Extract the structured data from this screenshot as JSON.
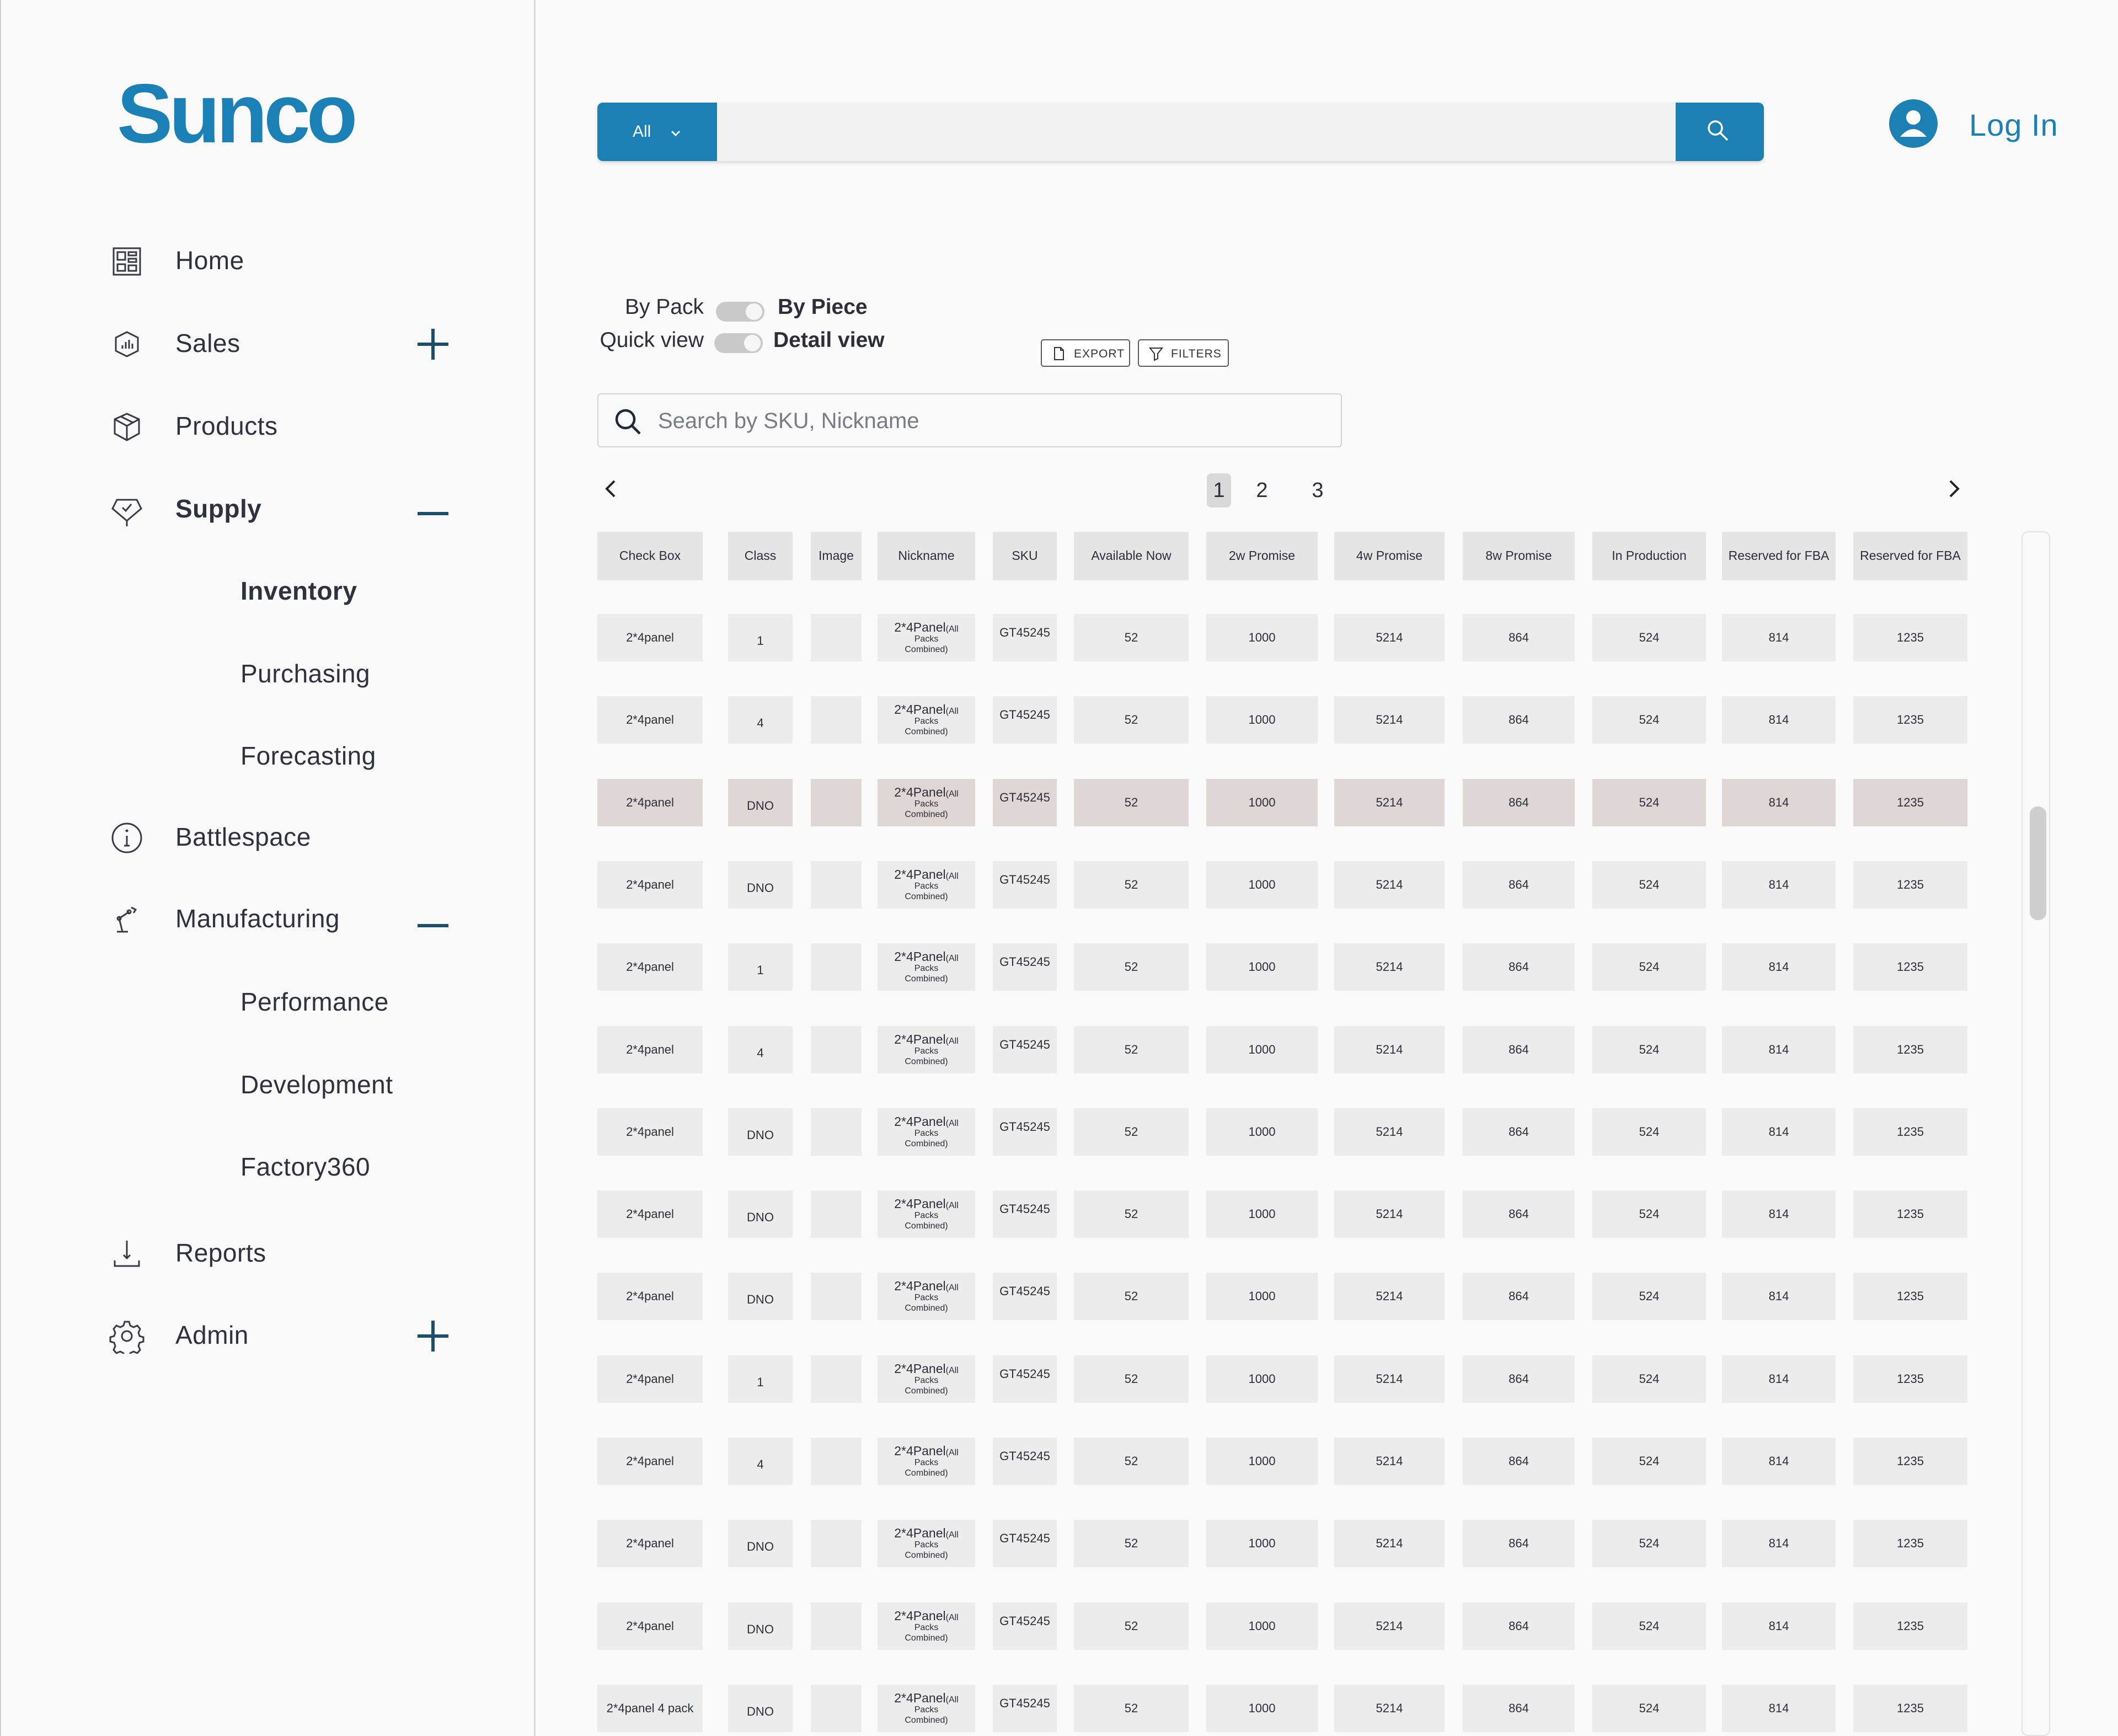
{
  "brand": {
    "logo": "Sunco"
  },
  "sidebar": {
    "items": [
      {
        "label": "Home",
        "icon": "dashboard-icon",
        "toggle": null
      },
      {
        "label": "Sales",
        "icon": "sales-icon",
        "toggle": "plus"
      },
      {
        "label": "Products",
        "icon": "box-icon",
        "toggle": null
      },
      {
        "label": "Supply",
        "icon": "supply-icon",
        "toggle": "minus",
        "active": true,
        "children": [
          {
            "label": "Inventory",
            "active": true
          },
          {
            "label": "Purchasing"
          },
          {
            "label": "Forecasting"
          }
        ]
      },
      {
        "label": "Battlespace",
        "icon": "info-icon",
        "toggle": null
      },
      {
        "label": "Manufacturing",
        "icon": "robot-arm-icon",
        "toggle": "minus",
        "children": [
          {
            "label": "Performance"
          },
          {
            "label": "Development"
          },
          {
            "label": "Factory360"
          }
        ]
      },
      {
        "label": "Reports",
        "icon": "download-icon",
        "toggle": null
      },
      {
        "label": "Admin",
        "icon": "gear-icon",
        "toggle": "plus"
      }
    ]
  },
  "header": {
    "search": {
      "category": "All",
      "value": ""
    },
    "login_label": "Log In"
  },
  "view_toggles": {
    "pack": {
      "off_label": "By Pack",
      "on_label": "By Piece"
    },
    "view": {
      "off_label": "Quick view",
      "on_label": "Detail view"
    }
  },
  "actions": {
    "export_label": "EXPORT",
    "filters_label": "FILTERS"
  },
  "sku_search": {
    "placeholder": "Search by SKU, Nickname"
  },
  "pagination": {
    "pages": [
      "1",
      "2",
      "3"
    ],
    "current": "1"
  },
  "table": {
    "columns": [
      "Check Box",
      "Class",
      "Image",
      "Nickname",
      "SKU",
      "Available Now",
      "2w Promise",
      "4w Promise",
      "8w Promise",
      "In Production",
      "Reserved for FBA",
      "Reserved for FBA"
    ],
    "rows": [
      {
        "check": "2*4panel",
        "class": "1",
        "nick": "2*4Panel",
        "nick_note1": "(All",
        "nick_note2": "Packs",
        "nick_note3": "Combined)",
        "sku": "GT45245",
        "avail": "52",
        "w2": "1000",
        "w4": "5214",
        "w8": "864",
        "prod": "524",
        "fba1": "814",
        "fba2": "1235"
      },
      {
        "check": "2*4panel",
        "class": "4",
        "nick": "2*4Panel",
        "nick_note1": "(All",
        "nick_note2": "Packs",
        "nick_note3": "Combined)",
        "sku": "GT45245",
        "avail": "52",
        "w2": "1000",
        "w4": "5214",
        "w8": "864",
        "prod": "524",
        "fba1": "814",
        "fba2": "1235"
      },
      {
        "check": "2*4panel",
        "class": "DNO",
        "nick": "2*4Panel",
        "nick_note1": "(All",
        "nick_note2": "Packs",
        "nick_note3": "Combined)",
        "sku": "GT45245",
        "avail": "52",
        "w2": "1000",
        "w4": "5214",
        "w8": "864",
        "prod": "524",
        "fba1": "814",
        "fba2": "1235",
        "highlight": true
      },
      {
        "check": "2*4panel",
        "class": "DNO",
        "nick": "2*4Panel",
        "nick_note1": "(All",
        "nick_note2": "Packs",
        "nick_note3": "Combined)",
        "sku": "GT45245",
        "avail": "52",
        "w2": "1000",
        "w4": "5214",
        "w8": "864",
        "prod": "524",
        "fba1": "814",
        "fba2": "1235"
      },
      {
        "check": "2*4panel",
        "class": "1",
        "nick": "2*4Panel",
        "nick_note1": "(All",
        "nick_note2": "Packs",
        "nick_note3": "Combined)",
        "sku": "GT45245",
        "avail": "52",
        "w2": "1000",
        "w4": "5214",
        "w8": "864",
        "prod": "524",
        "fba1": "814",
        "fba2": "1235"
      },
      {
        "check": "2*4panel",
        "class": "4",
        "nick": "2*4Panel",
        "nick_note1": "(All",
        "nick_note2": "Packs",
        "nick_note3": "Combined)",
        "sku": "GT45245",
        "avail": "52",
        "w2": "1000",
        "w4": "5214",
        "w8": "864",
        "prod": "524",
        "fba1": "814",
        "fba2": "1235"
      },
      {
        "check": "2*4panel",
        "class": "DNO",
        "nick": "2*4Panel",
        "nick_note1": "(All",
        "nick_note2": "Packs",
        "nick_note3": "Combined)",
        "sku": "GT45245",
        "avail": "52",
        "w2": "1000",
        "w4": "5214",
        "w8": "864",
        "prod": "524",
        "fba1": "814",
        "fba2": "1235"
      },
      {
        "check": "2*4panel",
        "class": "DNO",
        "nick": "2*4Panel",
        "nick_note1": "(All",
        "nick_note2": "Packs",
        "nick_note3": "Combined)",
        "sku": "GT45245",
        "avail": "52",
        "w2": "1000",
        "w4": "5214",
        "w8": "864",
        "prod": "524",
        "fba1": "814",
        "fba2": "1235"
      },
      {
        "check": "2*4panel",
        "class": "DNO",
        "nick": "2*4Panel",
        "nick_note1": "(All",
        "nick_note2": "Packs",
        "nick_note3": "Combined)",
        "sku": "GT45245",
        "avail": "52",
        "w2": "1000",
        "w4": "5214",
        "w8": "864",
        "prod": "524",
        "fba1": "814",
        "fba2": "1235"
      },
      {
        "check": "2*4panel",
        "class": "1",
        "nick": "2*4Panel",
        "nick_note1": "(All",
        "nick_note2": "Packs",
        "nick_note3": "Combined)",
        "sku": "GT45245",
        "avail": "52",
        "w2": "1000",
        "w4": "5214",
        "w8": "864",
        "prod": "524",
        "fba1": "814",
        "fba2": "1235"
      },
      {
        "check": "2*4panel",
        "class": "4",
        "nick": "2*4Panel",
        "nick_note1": "(All",
        "nick_note2": "Packs",
        "nick_note3": "Combined)",
        "sku": "GT45245",
        "avail": "52",
        "w2": "1000",
        "w4": "5214",
        "w8": "864",
        "prod": "524",
        "fba1": "814",
        "fba2": "1235"
      },
      {
        "check": "2*4panel",
        "class": "DNO",
        "nick": "2*4Panel",
        "nick_note1": "(All",
        "nick_note2": "Packs",
        "nick_note3": "Combined)",
        "sku": "GT45245",
        "avail": "52",
        "w2": "1000",
        "w4": "5214",
        "w8": "864",
        "prod": "524",
        "fba1": "814",
        "fba2": "1235"
      },
      {
        "check": "2*4panel",
        "class": "DNO",
        "nick": "2*4Panel",
        "nick_note1": "(All",
        "nick_note2": "Packs",
        "nick_note3": "Combined)",
        "sku": "GT45245",
        "avail": "52",
        "w2": "1000",
        "w4": "5214",
        "w8": "864",
        "prod": "524",
        "fba1": "814",
        "fba2": "1235"
      },
      {
        "check": "2*4panel 4 pack",
        "class": "DNO",
        "nick": "2*4Panel",
        "nick_note1": "(All",
        "nick_note2": "Packs",
        "nick_note3": "Combined)",
        "sku": "GT45245",
        "avail": "52",
        "w2": "1000",
        "w4": "5214",
        "w8": "864",
        "prod": "524",
        "fba1": "814",
        "fba2": "1235"
      }
    ]
  },
  "colors": {
    "brand": "#1a80b6",
    "highlight_row": "#dfd6d6",
    "cell": "#ececec"
  }
}
